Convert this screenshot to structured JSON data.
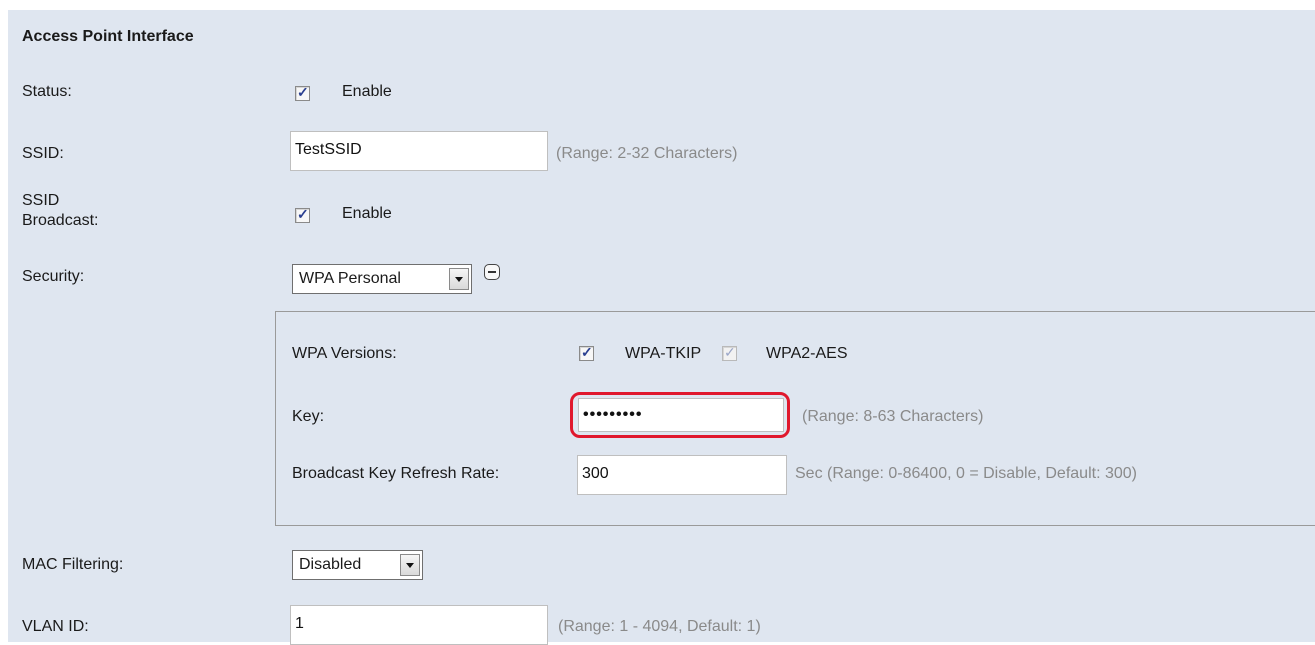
{
  "section_title": "Access Point Interface",
  "status": {
    "label": "Status:",
    "checked": true,
    "option_label": "Enable"
  },
  "ssid": {
    "label": "SSID:",
    "value": "TestSSID",
    "hint": "(Range: 2-32 Characters)"
  },
  "ssid_broadcast": {
    "label_line1": "SSID",
    "label_line2": "Broadcast:",
    "checked": true,
    "option_label": "Enable"
  },
  "security": {
    "label": "Security:",
    "selected": "WPA Personal"
  },
  "wpa": {
    "versions_label": "WPA Versions:",
    "tkip_label": "WPA-TKIP",
    "tkip_checked": true,
    "aes_label": "WPA2-AES",
    "aes_checked": true,
    "key_label": "Key:",
    "key_value": "•••••••••",
    "key_hint": "(Range: 8-63 Characters)",
    "refresh_label": "Broadcast Key Refresh Rate:",
    "refresh_value": "300",
    "refresh_hint": "Sec (Range: 0-86400, 0 = Disable, Default: 300)"
  },
  "mac_filtering": {
    "label": "MAC Filtering:",
    "selected": "Disabled"
  },
  "vlan": {
    "label": "VLAN ID:",
    "value": "1",
    "hint": "(Range: 1 - 4094, Default: 1)"
  },
  "colors": {
    "panel_bg": "#dfe6f0",
    "highlight": "#e0182d",
    "hint_text": "#8a8a8a",
    "checkmark": "#2a3f90"
  }
}
